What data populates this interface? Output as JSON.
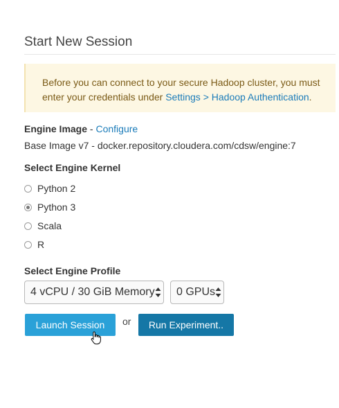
{
  "page": {
    "title": "Start New Session"
  },
  "alert": {
    "text_before": "Before you can connect to your secure Hadoop cluster, you must enter your credentials under ",
    "link": "Settings > Hadoop Authentication",
    "text_after": "."
  },
  "engine_image": {
    "label": "Engine Image",
    "separator": " - ",
    "configure_link": "Configure",
    "value": "Base Image v7 - docker.repository.cloudera.com/cdsw/engine:7"
  },
  "kernel": {
    "label": "Select Engine Kernel",
    "options": [
      {
        "label": "Python 2",
        "selected": false
      },
      {
        "label": "Python 3",
        "selected": true
      },
      {
        "label": "Scala",
        "selected": false
      },
      {
        "label": "R",
        "selected": false
      }
    ]
  },
  "profile": {
    "label": "Select Engine Profile",
    "cpu_memory": "4 vCPU / 30 GiB Memory",
    "gpus": "0 GPUs"
  },
  "actions": {
    "launch": "Launch Session",
    "or": "or",
    "run": "Run Experiment.."
  },
  "colors": {
    "launch_button": "#2aa1d8",
    "run_button": "#1577a6",
    "link": "#1a7bb9",
    "alert_bg": "#fdf7e3",
    "alert_text": "#7a5a16"
  }
}
